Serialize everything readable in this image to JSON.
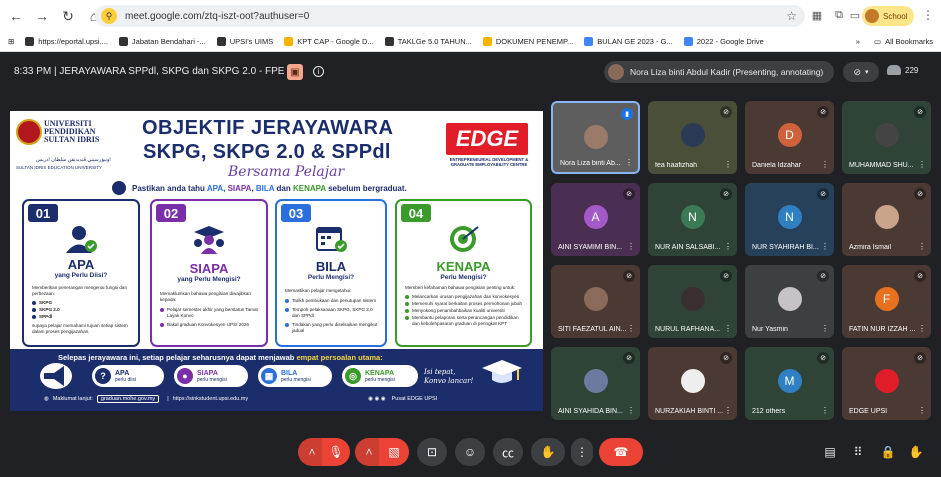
{
  "browser": {
    "url": "meet.google.com/ztq-iszt-oot?authuser=0",
    "profile_label": "School",
    "bookmarks": [
      {
        "label": "https://eportal.upsi....",
        "color": "#333333"
      },
      {
        "label": "Jabatan Bendahari -...",
        "color": "#333333"
      },
      {
        "label": "UPSI's UIMS",
        "color": "#333333"
      },
      {
        "label": "KPT CAP - Google D...",
        "color": "#f4b400"
      },
      {
        "label": "TAKLGe 5.0 TAHUN...",
        "color": "#333333"
      },
      {
        "label": "DOKUMEN PENEMP...",
        "color": "#f4b400"
      },
      {
        "label": "BULAN GE 2023 - G...",
        "color": "#4285f4"
      },
      {
        "label": "2022 - Google Drive",
        "color": "#4285f4"
      }
    ],
    "all_bookmarks": "All Bookmarks"
  },
  "meet": {
    "header_title": "8:33 PM  |  JERAYAWARA SPPdl, SKPG dan SKPG 2.0 - FPE",
    "presenter_label": "Nora Liza binti Abdul Kadir (Presenting, annotating)",
    "participant_count": "229"
  },
  "slide": {
    "univ_line1": "UNIVERSITI",
    "univ_line2": "PENDIDIKAN",
    "univ_line3": "SULTAN IDRIS",
    "univ_jawi": "اونيۏرسيتي ڤنديديقن سلطان ادريس",
    "univ_sub": "SULTAN IDRIS EDUCATION UNIVERSITY",
    "title1": "OBJEKTIF JERAYAWARA",
    "title2": "SKPG, SKPG 2.0 & SPPdl",
    "script": "Bersama Pelajar",
    "edge_logo": "EDGE",
    "edge_sub": "ENTREPRENEURIAL DEVELOPMENT & GRADUATE EMPLOYABILITY CENTRE",
    "banner_pre": "Pastikan anda tahu ",
    "banner_apa": "APA",
    "banner_siapa": "SIAPA",
    "banner_bila": "BILA",
    "banner_dan": " dan ",
    "banner_kenapa": "KENAPA",
    "banner_post": " sebelum bergraduat.",
    "cards": [
      {
        "num": "01",
        "big": "APA",
        "sm": "yang Perlu Diisi?",
        "intro": "Memberikan penerangan mengenai fungsi dan perbezaan:",
        "items": [
          "SKPG",
          "SKPG 2.0",
          "SPPdl"
        ],
        "outro": "supaya pelajar memahami tujuan setiap sistem dalam proses pengijazahan."
      },
      {
        "num": "02",
        "big": "SIAPA",
        "sm": "yang Perlu Mengisi?",
        "intro": "Memaklumkan bahawa pengisian diwajibkan kepada:",
        "items": [
          "Pelajar semester akhir yang berstatus Tamat Layak Konvo",
          "Bakal graduan Konvokesyen UPSI 2026"
        ]
      },
      {
        "num": "03",
        "big": "BILA",
        "sm": "Perlu Mengisi?",
        "intro": "Memastikan pelajar mengetahui:",
        "items": [
          "Tarikh pembukaan dan penutupan sistem",
          "Tempoh pelaksanaan SKPG, SKPG 2.0 dan SPPdl",
          "Tindakan yang perlu diselsaikan mengikut jadual"
        ]
      },
      {
        "num": "04",
        "big": "KENAPA",
        "sm": "Perlu Mengisi?",
        "intro": "Memberi kefahaman bahawa pengisian penting untuk:",
        "items": [
          "Melancarkan urusan pengijazahan dan konvokesyen",
          "Memenuhi syarat berkaitan proses permohonan jubah",
          "Menyokong penambahbaikan kualiti universiti",
          "Membantu pelaporan serta perancangan pendidikan dan kebolehpasaran graduan di peringkat KPT"
        ]
      }
    ],
    "bottom_q_pre": "Selepas jerayawara ini, setiap pelajar seharusnya dapat menjawab ",
    "bottom_q_hl": "empat persoalan utama:",
    "pills": [
      {
        "icon": "?",
        "t": "APA",
        "s": "perlu diisi",
        "color": "#1b2d6b"
      },
      {
        "icon": "●",
        "t": "SIAPA",
        "s": "perlu mengisi",
        "color": "#7a2fa8"
      },
      {
        "icon": "▦",
        "t": "BILA",
        "s": "perlu mengisi",
        "color": "#2a6fdb"
      },
      {
        "icon": "◎",
        "t": "KENAPA",
        "s": "perlu mengisi",
        "color": "#3a9a2a"
      }
    ],
    "isi_line1": "Isi tepat,",
    "isi_line2": "Konvo lancar!",
    "footer_label": "Maklumat lanjut:",
    "footer_link1": "graduan.mohe.gov.my",
    "footer_link2": "https://sinkstudent.upsi.edu.my",
    "footer_social": "Pusat EDGE UPSI"
  },
  "tiles": [
    {
      "name": "Nora Liza binti Ab...",
      "avatar": "",
      "bg": "#5e5e5e",
      "av_color": "#9a7b6a",
      "active": true
    },
    {
      "name": "fea haafizhah",
      "avatar": "",
      "bg": "#4a4f3a",
      "av_color": "#2b3a55"
    },
    {
      "name": "Daniela Idzahar",
      "avatar": "D",
      "bg": "#4b3a33",
      "av_color": "#d0623b"
    },
    {
      "name": "MUHAMMAD SHU...",
      "avatar": "",
      "bg": "#2f4436",
      "av_color": "#444444"
    },
    {
      "name": "AINI SYAMIMI BIN...",
      "avatar": "A",
      "bg": "#4a2f52",
      "av_color": "#a35ac8"
    },
    {
      "name": "NUR AIN SALSABI...",
      "avatar": "N",
      "bg": "#2f4436",
      "av_color": "#3b7a55"
    },
    {
      "name": "NUR SYAHIRAH BI...",
      "avatar": "N",
      "bg": "#27415a",
      "av_color": "#2f80c2"
    },
    {
      "name": "Azmira Ismail",
      "avatar": "",
      "bg": "#4b3a33",
      "av_color": "#c9a48a"
    },
    {
      "name": "SITI FAEZATUL AIN...",
      "avatar": "",
      "bg": "#4b3a33",
      "av_color": "#8a6b5a"
    },
    {
      "name": "NURUL RAFHANA...",
      "avatar": "",
      "bg": "#2f4436",
      "av_color": "#3a2f2f"
    },
    {
      "name": "Nur Yasmin",
      "avatar": "",
      "bg": "#3c4043",
      "av_color": "#c7c2c8"
    },
    {
      "name": "FATIN NUR IZZAH ...",
      "avatar": "F",
      "bg": "#4b3a33",
      "av_color": "#e8711f"
    },
    {
      "name": "AINI SYAHIDA BIN...",
      "avatar": "",
      "bg": "#2f4436",
      "av_color": "#6c7aa0"
    },
    {
      "name": "NURZAKIAH BINTI ...",
      "avatar": "",
      "bg": "#4b3a33",
      "av_color": "#eeeeee"
    },
    {
      "name": "212 others",
      "avatar": "M",
      "bg": "#2f4436",
      "av_color": "#2f80c2"
    },
    {
      "name": "EDGE UPSI",
      "avatar": "",
      "bg": "#4b3a33",
      "av_color": "#e11d2a"
    }
  ]
}
